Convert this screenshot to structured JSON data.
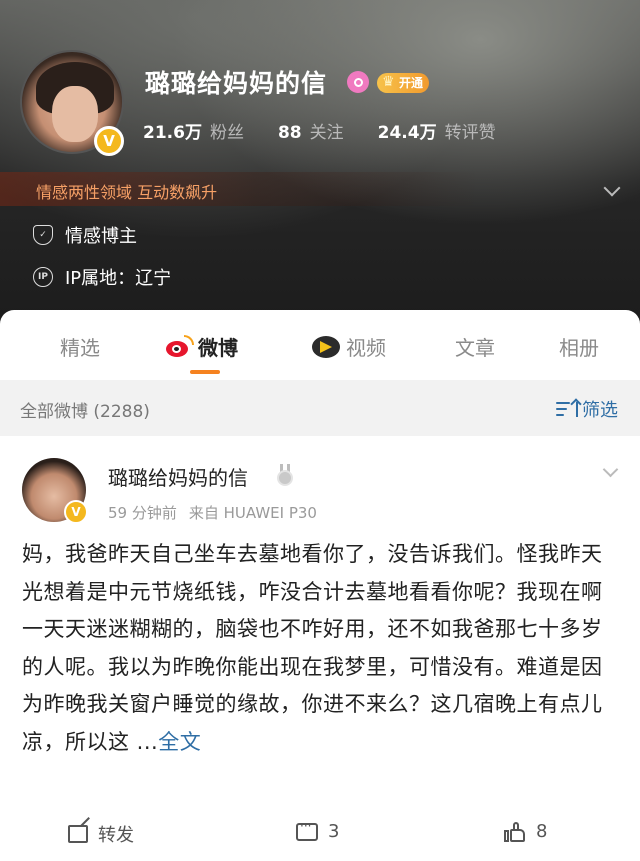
{
  "profile": {
    "name": "璐璐给妈妈的信",
    "vip_label": "开通",
    "verified_mark": "V",
    "stats": [
      {
        "num": "21.6万",
        "label": "粉丝"
      },
      {
        "num": "88",
        "label": "关注"
      },
      {
        "num": "24.4万",
        "label": "转评赞"
      }
    ],
    "tag_line": "情感两性领域 互动数飙升",
    "info": [
      {
        "icon": "shield-icon",
        "text": "情感博主"
      },
      {
        "icon": "ip-icon",
        "icon_text": "IP",
        "text": "IP属地：辽宁"
      }
    ]
  },
  "tabs": [
    {
      "label": "精选",
      "active": false
    },
    {
      "label": "微博",
      "active": true,
      "icon": "weibo-logo-icon"
    },
    {
      "label": "视频",
      "active": false,
      "icon": "video-play-icon"
    },
    {
      "label": "文章",
      "active": false
    },
    {
      "label": "相册",
      "active": false
    }
  ],
  "colors": {
    "accent": "#f58220",
    "link": "#2f6ea5",
    "tag_text": "#f6a066",
    "verified": "#f4b81e"
  },
  "filter": {
    "all_label": "全部微博 (2288)",
    "filter_label": "筛选"
  },
  "post": {
    "author": "璐璐给妈妈的信",
    "time": "59 分钟前",
    "source": "来自 HUAWEI P30",
    "body": "妈，我爸昨天自己坐车去墓地看你了，没告诉我们。怪我昨天光想着是中元节烧纸钱，咋没合计去墓地看看你呢？我现在啊一天天迷迷糊糊的，脑袋也不咋好用，还不如我爸那七十多岁的人呢。我以为昨晚你能出现在我梦里，可惜没有。难道是因为昨晚我关窗户睡觉的缘故，你进不来么？这几宿晚上有点儿凉，所以这 ...",
    "more_label": "全文",
    "actions": {
      "repost": "转发",
      "comments": "3",
      "likes": "8"
    }
  }
}
